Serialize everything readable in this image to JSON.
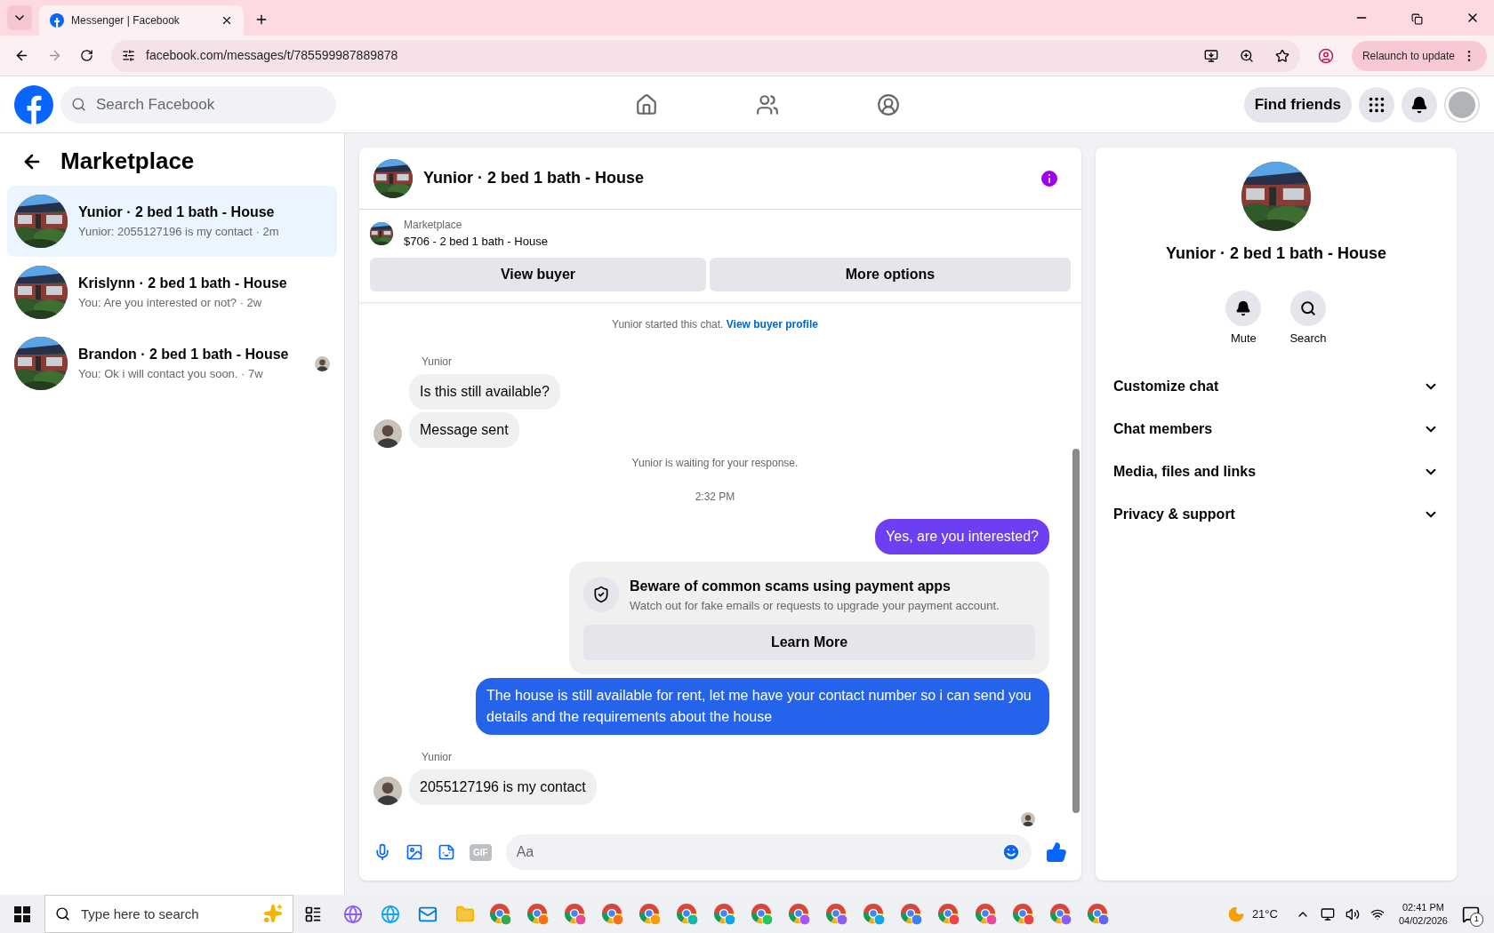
{
  "browser": {
    "tab_title": "Messenger | Facebook",
    "url": "facebook.com/messages/t/785599987889878",
    "relaunch_label": "Relaunch to update"
  },
  "header": {
    "search_placeholder": "Search Facebook",
    "find_friends": "Find friends"
  },
  "sidebar": {
    "title": "Marketplace",
    "conversations": [
      {
        "name": "Yunior · 2 bed 1 bath - House",
        "preview": "Yunior: 2055127196 is my contact · 2m",
        "selected": true,
        "read_receipt": false
      },
      {
        "name": "Krislynn · 2 bed 1 bath - House",
        "preview": "You: Are you interested or not? · 2w",
        "selected": false,
        "read_receipt": false
      },
      {
        "name": "Brandon · 2 bed 1 bath - House",
        "preview": "You: Ok i will contact you soon. · 7w",
        "selected": false,
        "read_receipt": true
      }
    ]
  },
  "chat": {
    "title": "Yunior · 2 bed 1 bath - House",
    "listing": {
      "source": "Marketplace",
      "title": "$706 - 2 bed 1 bath - House"
    },
    "buttons": [
      "View buyer",
      "More options"
    ],
    "messages": [
      {
        "kind": "system",
        "text": "Yunior started this chat.",
        "link": "View buyer profile"
      },
      {
        "kind": "sender",
        "text": "Yunior"
      },
      {
        "kind": "incoming",
        "text": "Is this still available?",
        "avatar": false
      },
      {
        "kind": "incoming",
        "text": "Message sent",
        "avatar": true
      },
      {
        "kind": "system",
        "text": "Yunior is waiting for your response."
      },
      {
        "kind": "timestamp",
        "text": "2:32 PM"
      },
      {
        "kind": "outgoing",
        "text": "Yes, are you interested?",
        "color": "#6c3ff2"
      },
      {
        "kind": "notice",
        "title": "Beware of common scams using payment apps",
        "text": "Watch out for fake emails or requests to upgrade your payment account.",
        "button": "Learn More"
      },
      {
        "kind": "outgoing",
        "text": "The house is still available for rent, let me have your contact number so i can send you details and the requirements about the house",
        "color": "#2563eb"
      },
      {
        "kind": "sender",
        "text": "Yunior"
      },
      {
        "kind": "incoming",
        "text": "2055127196 is my contact",
        "avatar": true
      },
      {
        "kind": "seen"
      }
    ],
    "composer": {
      "gif_label": "GIF",
      "placeholder": "Aa"
    }
  },
  "details": {
    "name": "Yunior · 2 bed 1 bath - House",
    "actions": [
      {
        "kind": "mute",
        "label": "Mute"
      },
      {
        "kind": "search",
        "label": "Search"
      }
    ],
    "sections": [
      "Customize chat",
      "Chat members",
      "Media, files and links",
      "Privacy & support"
    ]
  },
  "taskbar": {
    "search_placeholder": "Type here to search",
    "temperature": "21°C",
    "time": "02:41 PM",
    "date": "04/02/2026",
    "notifications": "1"
  }
}
